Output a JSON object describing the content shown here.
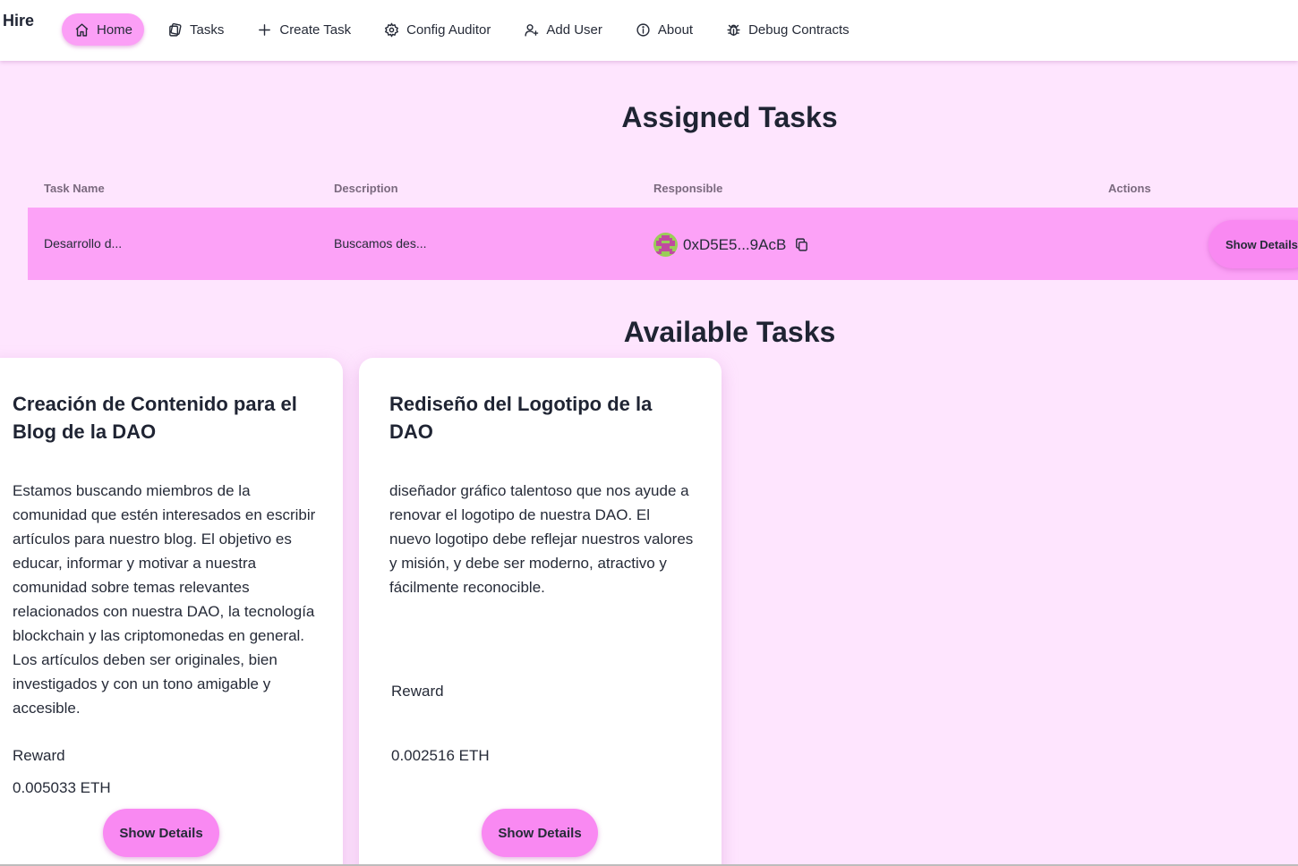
{
  "brand": "Hire",
  "nav": {
    "items": [
      {
        "label": "Home",
        "icon": "home-icon",
        "active": true
      },
      {
        "label": "Tasks",
        "icon": "tasks-icon"
      },
      {
        "label": "Create Task",
        "icon": "plus-icon"
      },
      {
        "label": "Config Auditor",
        "icon": "gear-icon"
      },
      {
        "label": "Add User",
        "icon": "add-user-icon"
      },
      {
        "label": "About",
        "icon": "info-icon"
      },
      {
        "label": "Debug Contracts",
        "icon": "bug-icon"
      }
    ]
  },
  "assigned": {
    "title": "Assigned Tasks",
    "columns": [
      "Task Name",
      "Description",
      "Responsible",
      "Actions"
    ],
    "rows": [
      {
        "task_name": "Desarrollo d...",
        "description": "Buscamos des...",
        "responsible": "0xD5E5...9AcB",
        "action": "Show Details"
      }
    ]
  },
  "available": {
    "title": "Available Tasks",
    "cards": [
      {
        "title": "Creación de Contenido para el Blog de la DAO",
        "description": "Estamos buscando miembros de la comunidad que estén interesados en escribir artículos para nuestro blog. El objetivo es educar, informar y motivar a nuestra comunidad sobre temas relevantes relacionados con nuestra DAO, la tecnología blockchain y las criptomonedas en general. Los artículos deben ser originales, bien investigados y con un tono amigable y accesible.",
        "reward_label": "Reward",
        "reward_value": "0.005033 ETH",
        "button": "Show Details"
      },
      {
        "title": "Rediseño del Logotipo de la DAO",
        "description": "diseñador gráfico talentoso que nos ayude a renovar el logotipo de nuestra DAO. El nuevo logotipo debe reflejar nuestros valores y misión, y debe ser moderno, atractivo y fácilmente reconocible.",
        "reward_label": "Reward",
        "reward_value": "0.002516 ETH",
        "button": "Show Details"
      }
    ]
  },
  "colors": {
    "page_bg": "#fee5fe",
    "accent": "#f989f2",
    "row_bg": "#fca2f7"
  }
}
